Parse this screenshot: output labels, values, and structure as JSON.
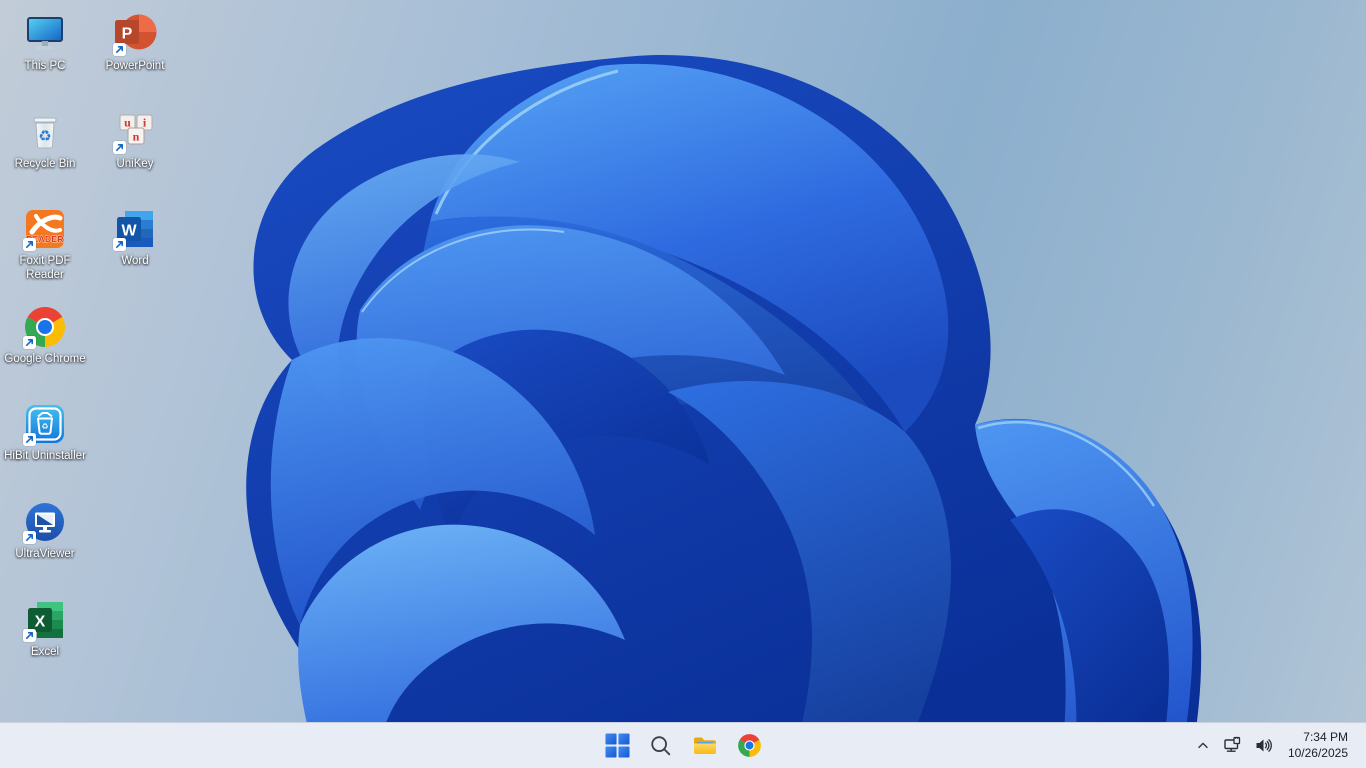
{
  "wallpaper": {
    "name": "windows-11-bloom",
    "background_left": "#c2ccd8",
    "background_right": "#8cafcd",
    "bloom_deep": "#0c34a0",
    "bloom_primary": "#2e6fe2",
    "bloom_light": "#5fa8f2",
    "bloom_rim": "#9fd2f8"
  },
  "desktop": {
    "icons": [
      {
        "label": "This PC"
      },
      {
        "label": "PowerPoint"
      },
      {
        "label": "Recycle Bin"
      },
      {
        "label": "UniKey"
      },
      {
        "label": "Foxit PDF Reader"
      },
      {
        "label": "Word"
      },
      {
        "label": "Google Chrome"
      },
      {
        "label": "HiBit Uninstaller"
      },
      {
        "label": "UltraViewer"
      },
      {
        "label": "Excel"
      }
    ]
  },
  "icon_art": {
    "powerpoint_letter": "P",
    "word_letter": "W",
    "excel_letter": "X",
    "foxit_badge": "READER",
    "unikey_keys": [
      "u",
      "i",
      "n"
    ],
    "recycle_glyph": "♻",
    "hibit_glyph": "♻"
  },
  "taskbar": {
    "buttons": [
      "start",
      "search",
      "file-explorer",
      "google-chrome"
    ],
    "tray_icons": [
      "chevron-up",
      "network-ethernet",
      "volume"
    ],
    "tray": {
      "time": "7:34 PM",
      "date": "10/26/2025"
    }
  }
}
